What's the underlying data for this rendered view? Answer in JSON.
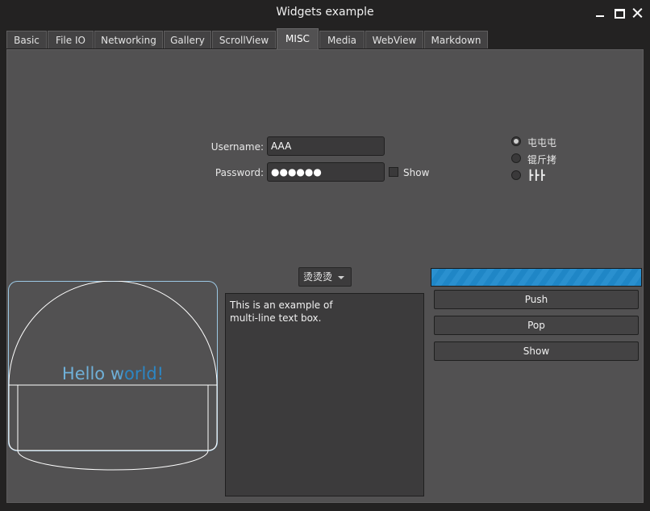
{
  "window": {
    "title": "Widgets example"
  },
  "tabs": [
    {
      "label": "Basic"
    },
    {
      "label": "File IO"
    },
    {
      "label": "Networking"
    },
    {
      "label": "Gallery"
    },
    {
      "label": "ScrollView"
    },
    {
      "label": "MISC"
    },
    {
      "label": "Media"
    },
    {
      "label": "WebView"
    },
    {
      "label": "Markdown"
    }
  ],
  "active_tab": "MISC",
  "form": {
    "username_label": "Username:",
    "username_value": "AAA",
    "password_label": "Password:",
    "password_value": "●●●●●●",
    "show_label": "Show"
  },
  "radios": [
    {
      "label": "屯屯屯",
      "checked": true
    },
    {
      "label": "锟斤拷",
      "checked": false
    },
    {
      "label": "┣┣┣",
      "checked": false
    }
  ],
  "canvas": {
    "text": "Hello world!"
  },
  "combo": {
    "value": "烫烫烫"
  },
  "textbox": {
    "value": "This is an example of\nmulti-line text box."
  },
  "progress": {
    "fraction": 1.0
  },
  "buttons": {
    "push": "Push",
    "pop": "Pop",
    "show": "Show"
  },
  "colors": {
    "accent": "#1f86c6",
    "background": "#525152",
    "window": "#232222"
  }
}
